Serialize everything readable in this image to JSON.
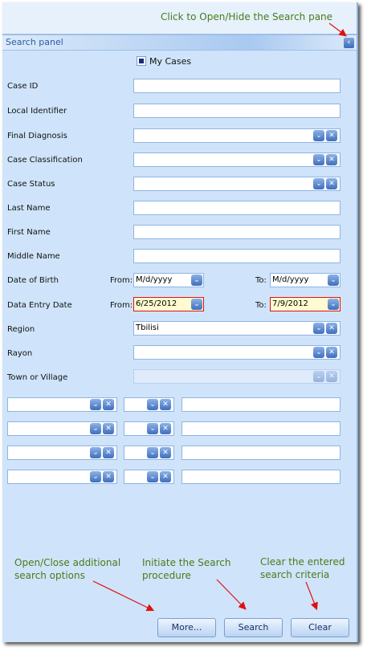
{
  "annotations": {
    "toggle": "Click to Open/Hide the Search pane",
    "more": [
      "Open/Close additional",
      "search options"
    ],
    "search": [
      "Initiate the Search",
      "procedure"
    ],
    "clear": [
      "Clear the entered",
      "search criteria"
    ]
  },
  "panel": {
    "title": "Search panel",
    "collapse_icon": "‹"
  },
  "my_cases": {
    "label": "My Cases",
    "checked": true
  },
  "fields": {
    "case_id": {
      "label": "Case ID",
      "value": ""
    },
    "local_id": {
      "label": "Local Identifier",
      "value": ""
    },
    "final_diagnosis": {
      "label": "Final Diagnosis",
      "value": ""
    },
    "case_classification": {
      "label": "Case Classification",
      "value": ""
    },
    "case_status": {
      "label": "Case Status",
      "value": ""
    },
    "last_name": {
      "label": "Last Name",
      "value": ""
    },
    "first_name": {
      "label": "First Name",
      "value": ""
    },
    "middle_name": {
      "label": "Middle Name",
      "value": ""
    },
    "dob": {
      "label": "Date of Birth",
      "from_label": "From:",
      "to_label": "To:",
      "from": "M/d/yyyy",
      "to": "M/d/yyyy"
    },
    "entry_date": {
      "label": "Data Entry Date",
      "from_label": "From:",
      "to_label": "To:",
      "from": "6/25/2012",
      "to": "7/9/2012"
    },
    "region": {
      "label": "Region",
      "value": "Tbilisi"
    },
    "rayon": {
      "label": "Rayon",
      "value": ""
    },
    "town": {
      "label": "Town or Village",
      "value": ""
    }
  },
  "buttons": {
    "more": "More...",
    "search": "Search",
    "clear": "Clear"
  },
  "colors": {
    "panel_bg": "#cfe4fa",
    "annotation": "#4b7a1a",
    "arrow": "#e01010",
    "invalid_border": "#e01010"
  }
}
